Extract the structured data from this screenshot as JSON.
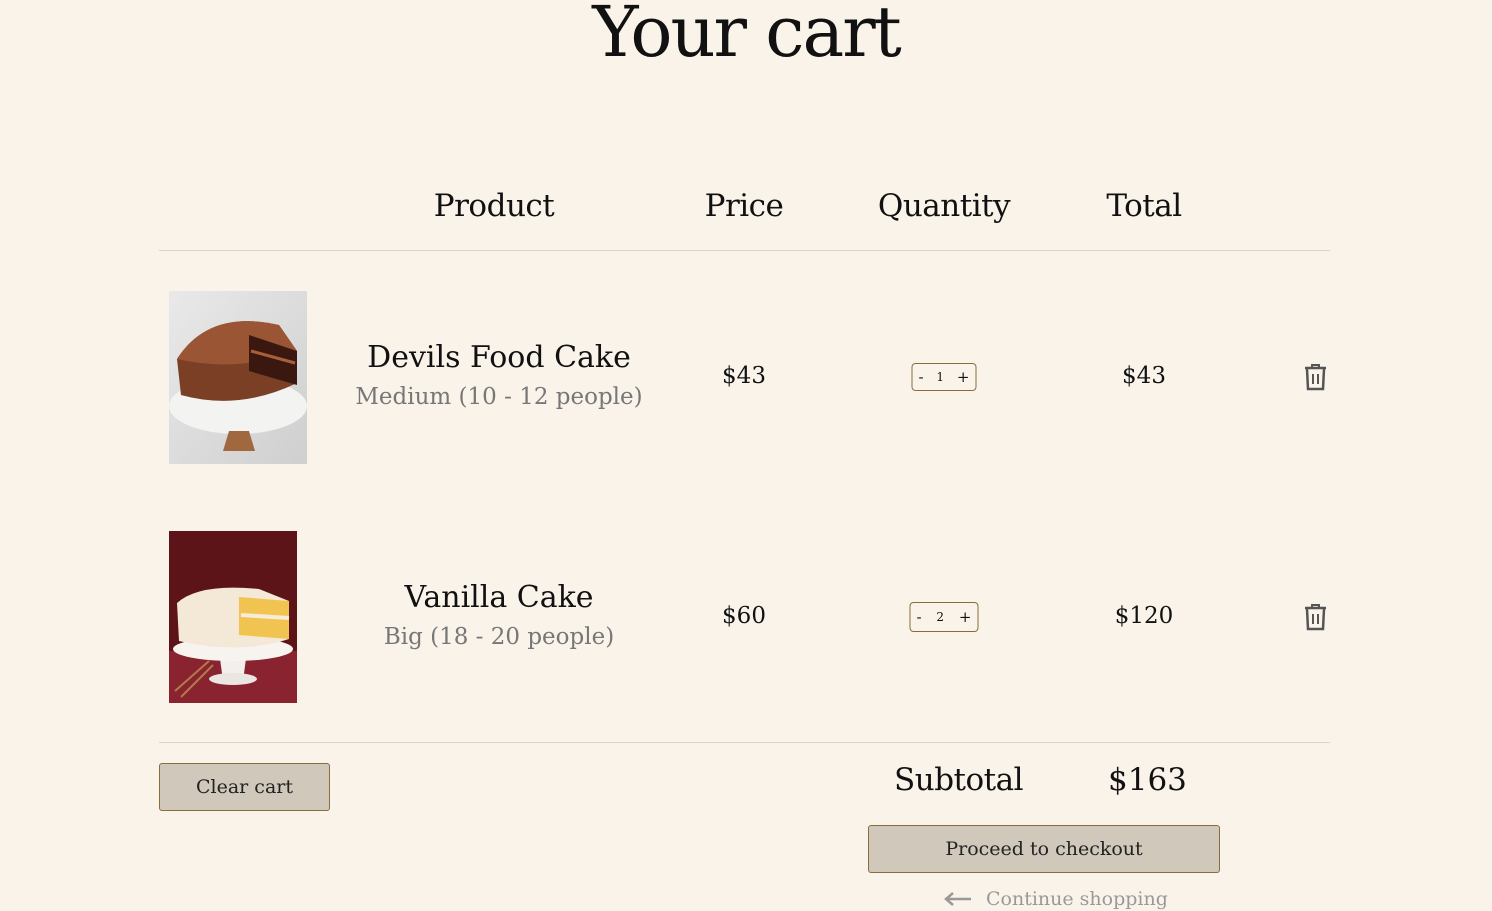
{
  "page": {
    "title": "Your cart"
  },
  "table": {
    "headers": {
      "product": "Product",
      "price": "Price",
      "quantity": "Quantity",
      "total": "Total"
    }
  },
  "items": [
    {
      "name": "Devils Food Cake",
      "variant": "Medium (10 - 12 people)",
      "price": "$43",
      "quantity": "1",
      "total": "$43",
      "image": "chocolate-cake-image"
    },
    {
      "name": "Vanilla Cake",
      "variant": "Big (18 - 20 people)",
      "price": "$60",
      "quantity": "2",
      "total": "$120",
      "image": "vanilla-cake-image"
    }
  ],
  "controls": {
    "decrement": "-",
    "increment": "+"
  },
  "footer": {
    "clear_cart": "Clear cart",
    "subtotal_label": "Subtotal",
    "subtotal_value": "$163",
    "checkout": "Proceed to checkout",
    "continue_shopping": "Continue shopping"
  },
  "colors": {
    "background": "#faf3ea",
    "button": "#cfc8bb",
    "border": "#8a6d3b"
  }
}
